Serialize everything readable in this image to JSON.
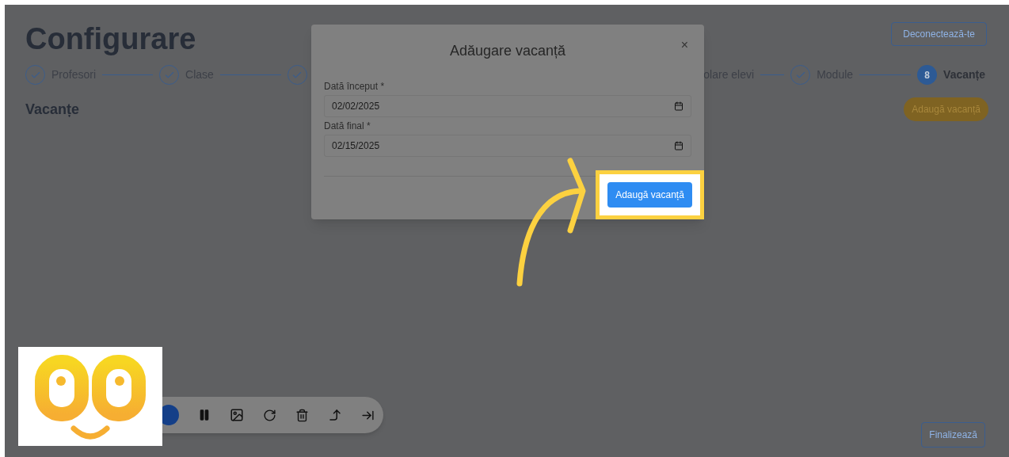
{
  "page": {
    "title": "Configurare",
    "logout_button": "Deconectează-te",
    "steps": [
      {
        "kind": "done",
        "label": "Profesori"
      },
      {
        "kind": "done",
        "label": "Clase"
      },
      {
        "kind": "done"
      },
      {
        "kind": "partial",
        "label": "olare elevi"
      },
      {
        "kind": "done",
        "label": "Module"
      },
      {
        "kind": "current",
        "number": "8",
        "label": "Vacanțe"
      }
    ],
    "section_title": "Vacanțe",
    "add_button": "Adaugă vacanță",
    "finish_button": "Finalizează"
  },
  "dialog": {
    "title": "Adăugare vacanță",
    "close": "×",
    "fields": [
      {
        "label": "Dată început *",
        "value": "02/02/2025"
      },
      {
        "label": "Dată final *",
        "value": "02/15/2025"
      }
    ],
    "submit_button": "Adaugă vacanță"
  }
}
